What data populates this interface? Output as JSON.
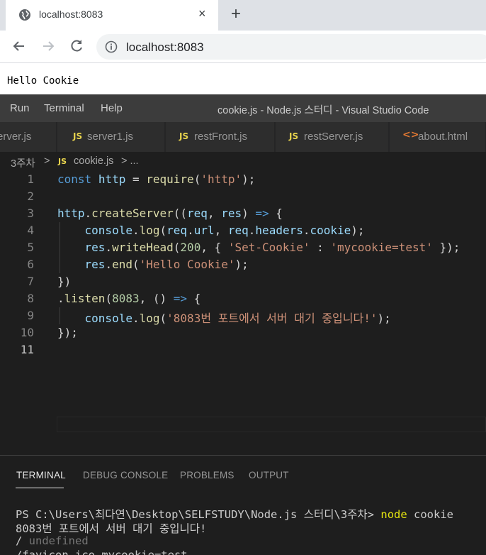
{
  "browser": {
    "tab_title": "localhost:8083",
    "close_label": "×",
    "new_tab_label": "+",
    "address": "localhost:8083",
    "page_text": "Hello Cookie"
  },
  "vscode": {
    "menu": [
      "Run",
      "Terminal",
      "Help"
    ],
    "window_title": "cookie.js - Node.js 스터디 - Visual Studio Code",
    "tabs": [
      {
        "label": "erver.js",
        "icon": ""
      },
      {
        "label": "server1.js",
        "icon": "JS"
      },
      {
        "label": "restFront.js",
        "icon": "JS"
      },
      {
        "label": "restServer.js",
        "icon": "JS"
      },
      {
        "label": "about.html",
        "icon": "<>"
      }
    ],
    "breadcrumb": {
      "folder": "3주차",
      "sep": ">",
      "icon": "JS",
      "file": "cookie.js",
      "rest": "> ..."
    },
    "line_numbers": [
      "1",
      "2",
      "3",
      "4",
      "5",
      "6",
      "7",
      "8",
      "9",
      "10",
      "11"
    ]
  },
  "panel": {
    "tabs": [
      "TERMINAL",
      "DEBUG CONSOLE",
      "PROBLEMS",
      "OUTPUT"
    ],
    "prompt": "PS C:\\Users\\최다연\\Desktop\\SELFSTUDY\\Node.js 스터디\\3주차> ",
    "command": "node",
    "argument": " cookie",
    "output_1": "8083번 포트에서 서버 대기 중입니다!",
    "output_2_path": "/ ",
    "output_2_value": "undefined",
    "output_3": "/favicon.ico mycookie=test"
  },
  "colors": {
    "keyword": "#569cd6",
    "variable": "#9cdcfe",
    "function": "#dcdcaa",
    "string": "#ce9178",
    "number": "#b5cea8"
  }
}
